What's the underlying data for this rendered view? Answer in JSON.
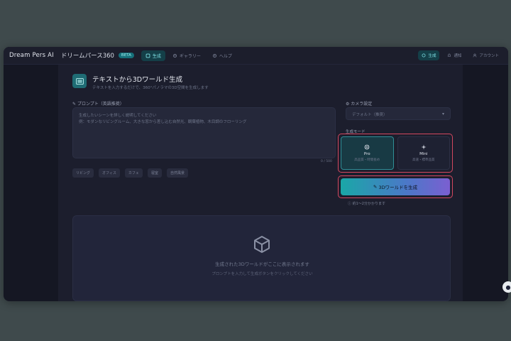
{
  "header": {
    "brand": "Dream Pers AI",
    "app_name": "ドリームパース360",
    "badge": "BETA",
    "nav": [
      {
        "label": "生成",
        "icon": "cube-icon",
        "active": true
      },
      {
        "label": "ギャラリー",
        "icon": "gear-icon",
        "active": false
      },
      {
        "label": "ヘルプ",
        "icon": "gear-icon",
        "active": false
      }
    ],
    "right": [
      {
        "label": "生成",
        "active": true
      },
      {
        "label": "通知",
        "active": false
      },
      {
        "label": "アカウント",
        "active": false
      }
    ]
  },
  "page": {
    "title": "テキストから3Dワールド生成",
    "subtitle": "テキストを入力するだけで、360°パノラマの3D空間を生成します"
  },
  "prompt": {
    "label": "プロンプト（英語推奨）",
    "lines": [
      "生成したいシーンを詳しく説明してください",
      "例：モダンなリビングルーム、大きな窓から差し込む自然光、観葉植物、木目調のフローリング"
    ],
    "char_count": "0 / 500",
    "tags": [
      "リビング",
      "オフィス",
      "カフェ",
      "寝室",
      "自然風景"
    ]
  },
  "camera": {
    "label": "カメラ設定",
    "selected": "デフォルト（推奨）"
  },
  "mode": {
    "label": "生成モード",
    "options": [
      {
        "name": "Pro",
        "desc": "高品質・時間長め",
        "selected": true
      },
      {
        "name": "Mini",
        "desc": "高速・標準品質",
        "selected": false
      }
    ]
  },
  "generate": {
    "label": "3Dワールドを生成",
    "hint": "約1〜2分かかります"
  },
  "preview": {
    "title": "生成された3Dワールドがここに表示されます",
    "subtitle": "プロンプトを入力して生成ボタンをクリックしてください"
  },
  "colors": {
    "accent": "#1aa7a7",
    "highlight": "#d4475f"
  }
}
